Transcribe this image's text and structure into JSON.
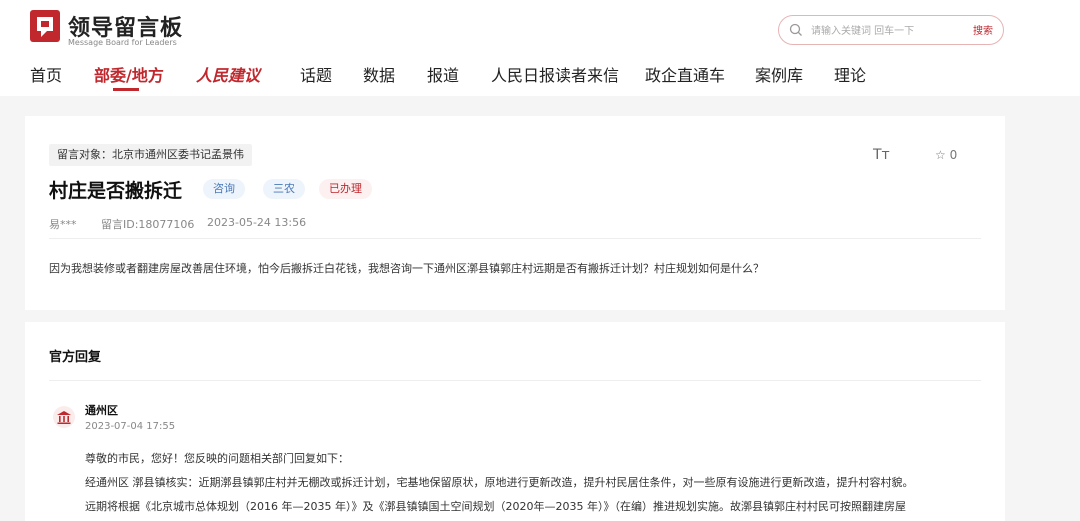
{
  "header": {
    "logo_title": "领导留言板",
    "logo_subtitle": "Message Board for Leaders",
    "search_placeholder": "请输入关键词 回车一下",
    "search_button": "搜索",
    "brand_color": "#c0282e"
  },
  "nav": {
    "items": [
      "首页",
      "部委/地方",
      "人民建议",
      "话题",
      "数据",
      "报道",
      "人民日报读者来信",
      "政企直通车",
      "案例库",
      "理论"
    ],
    "active_index": 1
  },
  "message": {
    "target": "留言对象：北京市通州区委书记孟景伟",
    "font_toggle": "Tт",
    "favorite_count": "☆ 0",
    "title": "村庄是否搬拆迁",
    "tags": [
      "咨询",
      "三农",
      "已办理"
    ],
    "author": "易***",
    "message_id": "留言ID:18077106",
    "datetime": "2023-05-24 13:56",
    "content": "因为我想装修或者翻建房屋改善居住环境，怕今后搬拆迁白花钱，我想咨询一下通州区漷县镇郭庄村远期是否有搬拆迁计划？村庄规划如何是什么？"
  },
  "reply": {
    "section_title": "官方回复",
    "department": "通州区",
    "date": "2023-07-04 17:55",
    "lines": [
      "尊敬的市民，您好！您反映的问题相关部门回复如下：",
      "经通州区 漷县镇核实：近期漷县镇郭庄村并无棚改或拆迁计划，宅基地保留原状，原地进行更新改造，提升村民居住条件，对一些原有设施进行更新改造，提升村容村貌。",
      "远期将根据《北京城市总体规划（2016 年—2035 年）》及《漷县镇镇国土空间规划（2020年—2035 年）》（在编）推进规划实施。故漷县镇郭庄村村民可按照翻建房屋"
    ]
  }
}
